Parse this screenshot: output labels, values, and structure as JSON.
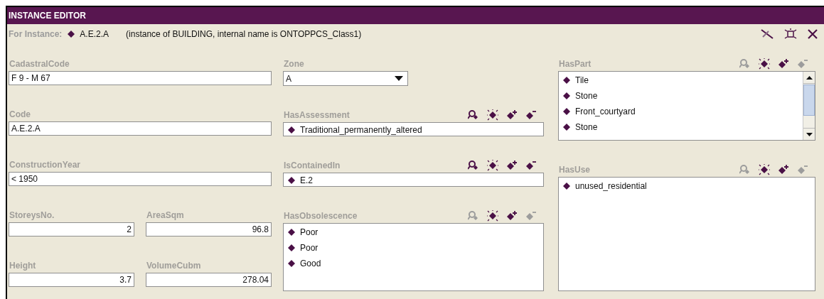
{
  "window": {
    "title": "INSTANCE EDITOR"
  },
  "for_instance": {
    "label": "For Instance:",
    "name": "A.E.2.A",
    "description": "(instance of BUILDING, internal name is ONTOPPCS_Class1)"
  },
  "columns": [
    {
      "fields": [
        {
          "kind": "text",
          "label": "CadastralCode",
          "value": "F 9 - M 67"
        },
        {
          "kind": "text",
          "label": "Code",
          "value": "A.E.2.A"
        },
        {
          "kind": "text",
          "label": "ConstructionYear",
          "value": "< 1950"
        },
        {
          "kind": "pair",
          "fields": [
            {
              "kind": "number",
              "label": "StoreysNo.",
              "value": "2"
            },
            {
              "kind": "number",
              "label": "AreaSqm",
              "value": "96.8"
            }
          ]
        },
        {
          "kind": "pair",
          "fields": [
            {
              "kind": "number",
              "label": "Height",
              "value": "3.7"
            },
            {
              "kind": "number",
              "label": "VolumeCubm",
              "value": "278.04"
            }
          ]
        }
      ]
    },
    {
      "fields": [
        {
          "kind": "select",
          "label": "Zone",
          "value": "A"
        },
        {
          "kind": "instance",
          "label": "HasAssessment",
          "items": [
            "Traditional_permanently_altered"
          ],
          "actions": [
            {
              "kind": "find",
              "disabled": false
            },
            {
              "kind": "create",
              "disabled": false
            },
            {
              "kind": "add",
              "disabled": false
            },
            {
              "kind": "remove",
              "disabled": false
            }
          ]
        },
        {
          "kind": "instance",
          "label": "IsContainedIn",
          "items": [
            "E.2"
          ],
          "actions": [
            {
              "kind": "find",
              "disabled": false
            },
            {
              "kind": "create",
              "disabled": false
            },
            {
              "kind": "add",
              "disabled": false
            },
            {
              "kind": "remove",
              "disabled": false
            }
          ]
        },
        {
          "kind": "list",
          "label": "HasObsolescence",
          "items": [
            "Poor",
            "Poor",
            "Good"
          ],
          "actions": [
            {
              "kind": "find",
              "disabled": true
            },
            {
              "kind": "create",
              "disabled": false
            },
            {
              "kind": "add",
              "disabled": false
            },
            {
              "kind": "remove",
              "disabled": true
            }
          ]
        }
      ]
    },
    {
      "fields": [
        {
          "kind": "list",
          "label": "HasPart",
          "items": [
            "Tile",
            "Stone",
            "Front_courtyard",
            "Stone"
          ],
          "scrollable": true,
          "actions": [
            {
              "kind": "find",
              "disabled": true
            },
            {
              "kind": "create",
              "disabled": false
            },
            {
              "kind": "add",
              "disabled": false
            },
            {
              "kind": "remove",
              "disabled": true
            }
          ]
        },
        {
          "kind": "list",
          "label": "HasUse",
          "items": [
            "unused_residential"
          ],
          "actions": [
            {
              "kind": "find",
              "disabled": true
            },
            {
              "kind": "create",
              "disabled": false
            },
            {
              "kind": "add",
              "disabled": false
            },
            {
              "kind": "remove",
              "disabled": true
            }
          ]
        }
      ]
    }
  ]
}
